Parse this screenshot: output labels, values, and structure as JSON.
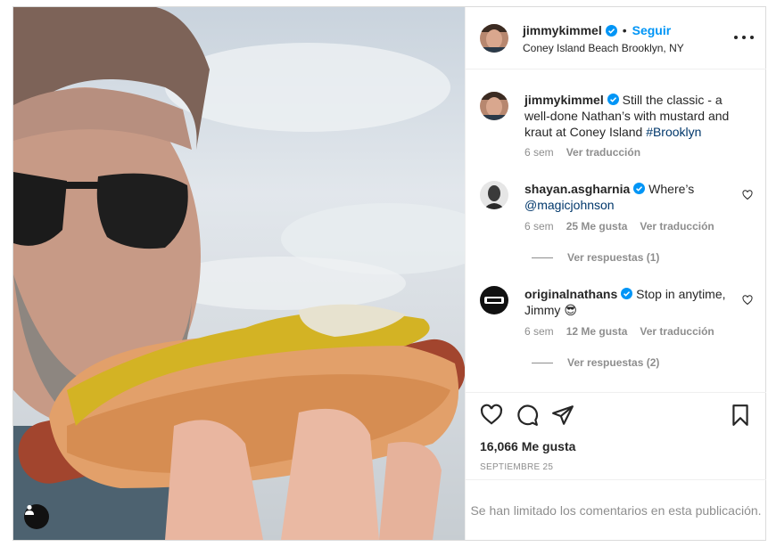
{
  "post": {
    "username": "jimmykimmel",
    "follow_label": "Seguir",
    "separator": "•",
    "location": "Coney Island Beach Brooklyn, NY",
    "caption_text": "Still the classic - a well-done Nathan’s with mustard and kraut at Coney Island ",
    "caption_hashtag": "#Brooklyn",
    "caption_time": "6 sem",
    "caption_translate": "Ver traducción",
    "likes": "16,066 Me gusta",
    "date": "SEPTIEMBRE 25",
    "comments_limited": "Se han limitado los comentarios en esta publicación."
  },
  "comments": [
    {
      "username": "shayan.asgharnia",
      "text_before": "Where’s ",
      "mention": "@magicjohnson",
      "time": "6 sem",
      "likes": "25 Me gusta",
      "translate": "Ver traducción",
      "replies": "Ver respuestas (1)"
    },
    {
      "username": "originalnathans",
      "text_before": "Stop in anytime, Jimmy ",
      "emoji": "😎",
      "time": "6 sem",
      "likes": "12 Me gusta",
      "translate": "Ver traducción",
      "replies": "Ver respuestas (2)"
    }
  ],
  "icons": {
    "verified": "verified-badge-icon",
    "more": "more-options-icon",
    "heart": "heart-icon",
    "comment": "comment-icon",
    "share": "share-icon",
    "save": "bookmark-icon",
    "user_tag": "user-tag-icon"
  },
  "colors": {
    "accent_blue": "#0095f6",
    "verified_blue": "#0095f6",
    "secondary_text": "#8e8e8e",
    "border": "#dbdbdb"
  }
}
